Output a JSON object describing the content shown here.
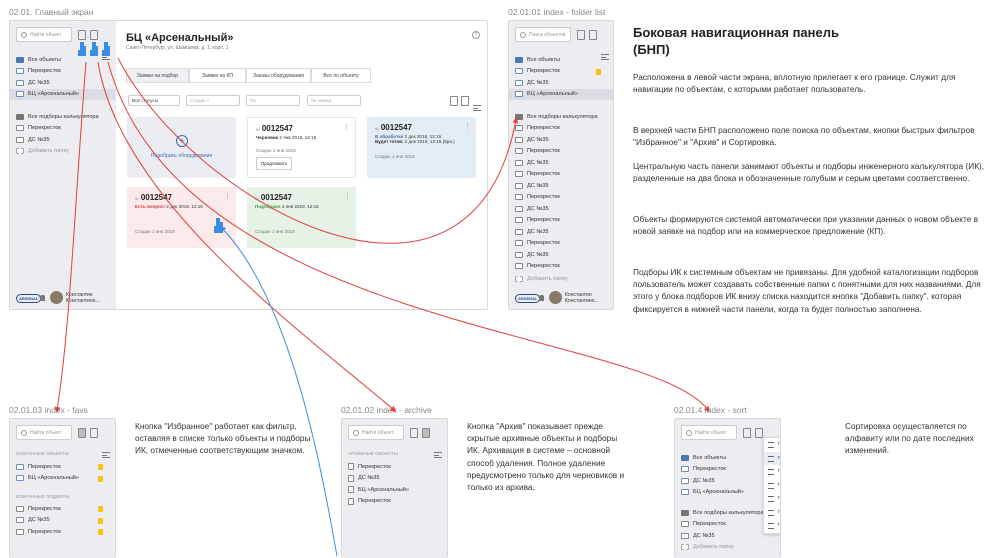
{
  "main": {
    "caption": "02.01. Главный экран",
    "search_placeholder": "Найти объект",
    "folders": [
      "Все объекты",
      "Перекресток",
      "ДС №35",
      "БЦ «Арсенальный»"
    ],
    "calc_header": "Все подборы калькулятора",
    "calc_items": [
      "Перекресток",
      "ДС №35"
    ],
    "add_folder": "Добавить папку",
    "user_name": "Константин Константино...",
    "logo": "ARSENAL",
    "title": "БЦ «Арсенальный»",
    "address": "Санкт-Петербург, ул. Шамшева, д. 1, корп. 1",
    "help_icon": "?",
    "tabs": [
      "Заявки на подбор",
      "Заявки на КП",
      "Заказы оборудования",
      "Все по объекту"
    ],
    "filters": {
      "status": "Все статусы",
      "from": "Создан с",
      "to": "По",
      "number": "№ заявки"
    },
    "add_card_label": "Подобрать оборудование",
    "cards": [
      {
        "prefix": "№",
        "number": "0012547",
        "status": "Черновик",
        "date": "2 янв 2019, 12:15",
        "created": "Создан 1 янв 2019",
        "button": "Продолжить"
      },
      {
        "prefix": "№",
        "number": "0012547",
        "status": "В обработке",
        "date": "2 дек 2019, 12:15",
        "extra_label": "Будет готов:",
        "extra": "2 дек 2019, 12:15 (6ра.)",
        "created": "Создан 1 янв 2019"
      },
      {
        "prefix": "№",
        "number": "0012547",
        "status": "Есть вопрос!",
        "date": "2 дек 2019, 12:15",
        "created": "Создан 1 янв 2019"
      },
      {
        "prefix": "№",
        "number": "0012547",
        "status": "Подобрано",
        "date": "2 янв 2019, 12:15",
        "created": "Создан 1 янв 2019"
      }
    ]
  },
  "folder_list": {
    "caption": "02.01.01 index - folder list",
    "search_placeholder": "Поиск объектов",
    "folders": [
      "Все объекты",
      "Перекресток",
      "ДС №35",
      "БЦ «Арсенальный»"
    ],
    "calc_header": "Все подборы калькулятора",
    "calc_items": [
      "Перекресток",
      "ДС №35",
      "Перекресток",
      "ДС №35",
      "Перекресток",
      "ДС №35",
      "Перекресток",
      "ДС №35",
      "Перекресток",
      "ДС №35",
      "Перекресток",
      "ДС №35",
      "Перекресток"
    ],
    "add_folder": "Добавить папку",
    "user_name": "Константин Константино..."
  },
  "info": {
    "title_line1": "Боковая навигационная панель",
    "title_line2": "(БНП)",
    "paragraphs": [
      "Расположена в левой части экрана, вплотную прилегает к его границе. Служит для навигации по объектам, с которыми работает пользователь.",
      "В верхней части БНП расположено поле поиска по объектам, кнопки быстрых фильтров \"Избранное\" и \"Архив\" и Сортировка.",
      "Центральную часть панели занимают объекты и подборы инженерного калькулятора (ИК), разделенные на два блока и обозначенные голубым и серым цветами соответственно.",
      "Объекты формируются системой автоматически при указании данных о новом объекте в новой заявке на подбор или на коммерческое предложение (КП).",
      "Подборы ИК к системным объектам не привязаны. Для удобной каталогизации подборов пользователь может создавать собственные папки с понятными для них названиями. Для этого у блока подборов ИК внизу списка находится кнопка \"Добавить папку\", которая фиксируется в нижней части панели, когда та будет полностью заполнена."
    ]
  },
  "favs": {
    "caption": "02.01.03 index - favs",
    "search_placeholder": "Найти объект",
    "section1": "ИЗБРАННЫЕ ОБЪЕКТЫ",
    "items1": [
      "Перекресток",
      "БЦ «Арсенальный»"
    ],
    "section2": "ИЗБРАННЫЕ ПОДБОРЫ",
    "items2": [
      "Перекресток",
      "ДС №35",
      "Перекресток"
    ],
    "description": "Кнопка \"Избранное\" работает как фильтр, оставляя в списке только объекты и подборы ИК, отмеченные соответствующим значком."
  },
  "archive": {
    "caption": "02.01.02 index - archive",
    "search_placeholder": "Найти объект",
    "section": "АРХИВНЫЕ ОБЪЕКТЫ",
    "items": [
      "Перекресток",
      "ДС №35",
      "БЦ «Арсенальный»",
      "Перекресток"
    ],
    "description": "Кнопка \"Архив\" показывает прежде скрытые архивные объекты и подборы ИК. Архивация в системе – основной способ удаления. Полное удаление предусмотрено только для черновиков и только из архива."
  },
  "sort": {
    "caption": "02.01.4 index - sort",
    "search_placeholder": "Найти объект",
    "folders": [
      "Все объекты",
      "Перекресток",
      "ДС №35",
      "БЦ «Арсенальный»"
    ],
    "calc_header": "Все подборы калькулятора",
    "calc_items": [
      "Перекресток",
      "ДС №35"
    ],
    "add_folder": "Добавить папку",
    "menu": [
      "По актуальности",
      "По актуальности",
      "По актуальности",
      "По дате",
      "По дате",
      "По названию",
      "По названию"
    ],
    "description": "Сортировка осуществляется по алфавиту или по дате последних изменений."
  },
  "colors": {
    "accent": "#3d6fb0",
    "arrow_red": "#e04040",
    "arrow_blue": "#3a8de0",
    "fav": "#f5c11a",
    "draft": "#ffffff",
    "processing": "#e3ecf5",
    "question": "#fbeaea",
    "done": "#e6f2e6"
  }
}
